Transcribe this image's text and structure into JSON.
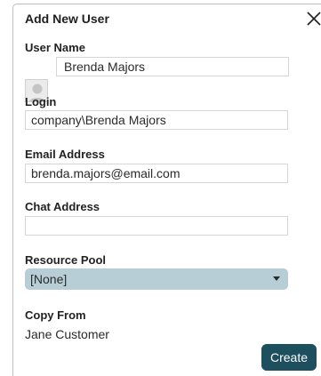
{
  "dialog": {
    "title": "Add New User"
  },
  "fields": {
    "user_name_label": "User Name",
    "user_name_value": "Brenda Majors",
    "login_label": "Login",
    "login_value": "company\\Brenda Majors",
    "email_label": "Email Address",
    "email_value": "brenda.majors@email.com",
    "chat_label": "Chat Address",
    "chat_value": "",
    "resource_pool_label": "Resource Pool",
    "resource_pool_value": "[None]",
    "copy_from_label": "Copy From",
    "copy_from_value": "Jane Customer"
  },
  "actions": {
    "create_label": "Create"
  },
  "icons": {
    "close": "close-icon",
    "avatar": "user-avatar-icon",
    "caret": "caret-down-icon"
  },
  "colors": {
    "select_bg": "#b8ced7",
    "create_bg": "#1d4f5e"
  }
}
